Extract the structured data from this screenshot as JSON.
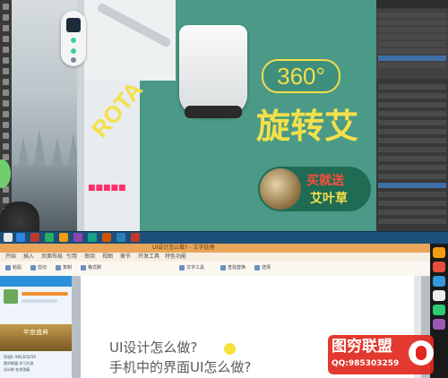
{
  "photoshop": {
    "canvas": {
      "badge": "360°",
      "title": "旋转艾",
      "diagonal_text": "ROTA",
      "promo_line1": "买就送",
      "promo_line2": "艾叶草",
      "red_tag": "■■■■■"
    },
    "colors": {
      "teal": "#4a9a87",
      "yellow": "#f4e04a",
      "dark_green": "#1f6b54"
    }
  },
  "word": {
    "title": "UI设计怎么做? - 文字处理",
    "menu": [
      "开始",
      "插入",
      "页面布局",
      "引用",
      "审阅",
      "视图",
      "章节",
      "开发工具",
      "特色功能"
    ],
    "ribbon": [
      "粘贴",
      "剪切",
      "复制",
      "格式刷",
      "文字工具",
      "查找替换",
      "选择"
    ],
    "document_lines": [
      "UI设计怎么做?",
      "手机中的界面UI怎么做?"
    ]
  },
  "qq": {
    "promo": "年度盛典",
    "lines": [
      "QQ群: 985303259",
      "图穷联盟 学习交流",
      "设计群 在线答疑"
    ]
  },
  "watermark": {
    "title": "图穷联盟",
    "qq": "QQ:985303259"
  }
}
